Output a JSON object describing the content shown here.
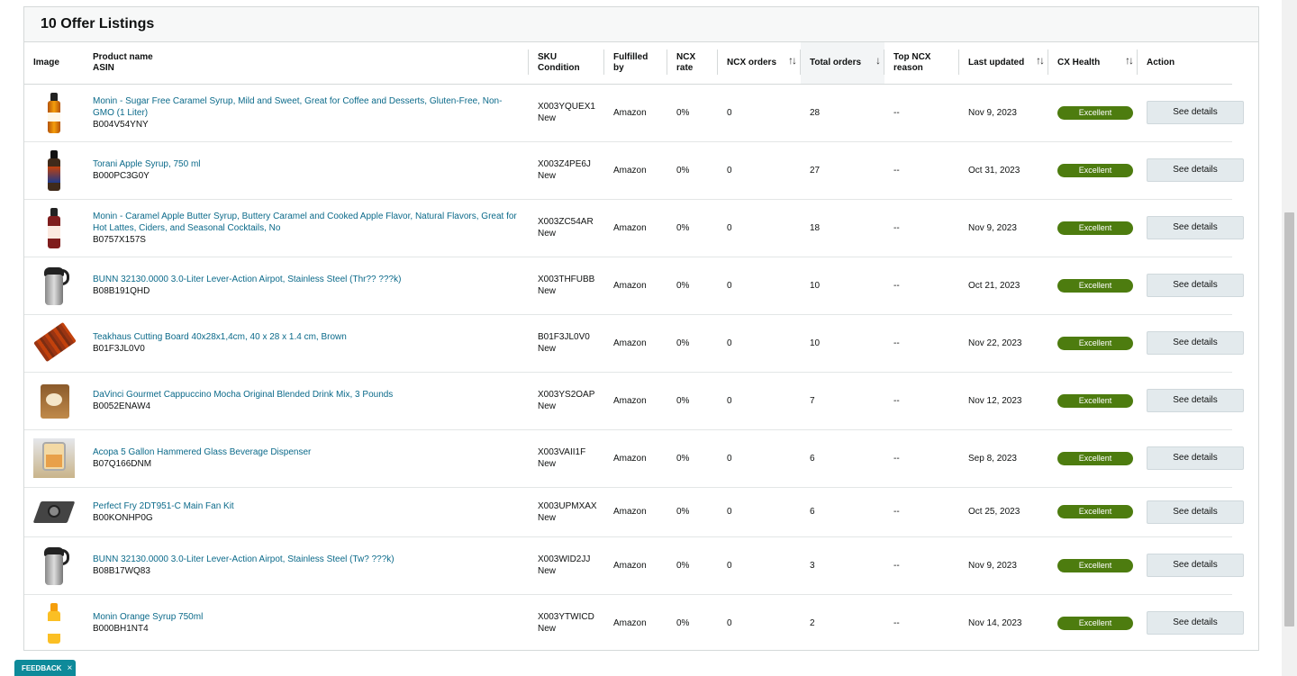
{
  "title": "10 Offer Listings",
  "columns": {
    "image": "Image",
    "product_name": "Product name",
    "asin": "ASIN",
    "sku": "SKU",
    "condition": "Condition",
    "fulfilled_by": "Fulfilled by",
    "ncx_rate": "NCX rate",
    "ncx_orders": "NCX orders",
    "total_orders": "Total orders",
    "top_ncx_reason": "Top NCX reason",
    "last_updated": "Last updated",
    "cx_health": "CX Health",
    "action": "Action"
  },
  "sort_icons": {
    "ncx_orders": "↑↓",
    "total_orders": "↓",
    "last_updated": "↑↓",
    "cx_health": "↑↓"
  },
  "rows": [
    {
      "thumb": "syrup-bottle-amber-icon",
      "name": "Monin - Sugar Free Caramel Syrup, Mild and Sweet, Great for Coffee and Desserts, Gluten-Free, Non-GMO (1 Liter)",
      "asin": "B004V54YNY",
      "sku": "X003YQUEX1",
      "condition": "New",
      "fulfilled_by": "Amazon",
      "ncx_rate": "0%",
      "ncx_orders": "0",
      "total_orders": "28",
      "top_ncx_reason": "--",
      "last_updated": "Nov 9, 2023",
      "cx_health": "Excellent",
      "action": "See details"
    },
    {
      "thumb": "syrup-bottle-dark-icon",
      "name": "Torani Apple Syrup, 750 ml",
      "asin": "B000PC3G0Y",
      "sku": "X003Z4PE6J",
      "condition": "New",
      "fulfilled_by": "Amazon",
      "ncx_rate": "0%",
      "ncx_orders": "0",
      "total_orders": "27",
      "top_ncx_reason": "--",
      "last_updated": "Oct 31, 2023",
      "cx_health": "Excellent",
      "action": "See details"
    },
    {
      "thumb": "syrup-bottle-red-icon",
      "name": "Monin - Caramel Apple Butter Syrup, Buttery Caramel and Cooked Apple Flavor, Natural Flavors, Great for Hot Lattes, Ciders, and Seasonal Cocktails, No",
      "asin": "B0757X157S",
      "sku": "X003ZC54AR",
      "condition": "New",
      "fulfilled_by": "Amazon",
      "ncx_rate": "0%",
      "ncx_orders": "0",
      "total_orders": "18",
      "top_ncx_reason": "--",
      "last_updated": "Nov 9, 2023",
      "cx_health": "Excellent",
      "action": "See details"
    },
    {
      "thumb": "airpot-icon",
      "name": "BUNN 32130.0000 3.0-Liter Lever-Action Airpot, Stainless Steel (Thr?? ???k)",
      "asin": "B08B191QHD",
      "sku": "X003THFUBB",
      "condition": "New",
      "fulfilled_by": "Amazon",
      "ncx_rate": "0%",
      "ncx_orders": "0",
      "total_orders": "10",
      "top_ncx_reason": "--",
      "last_updated": "Oct 21, 2023",
      "cx_health": "Excellent",
      "action": "See details"
    },
    {
      "thumb": "cutting-board-icon",
      "name": "Teakhaus Cutting Board 40x28x1,4cm, 40 x 28 x 1.4 cm, Brown",
      "asin": "B01F3JL0V0",
      "sku": "B01F3JL0V0",
      "condition": "New",
      "fulfilled_by": "Amazon",
      "ncx_rate": "0%",
      "ncx_orders": "0",
      "total_orders": "10",
      "top_ncx_reason": "--",
      "last_updated": "Nov 22, 2023",
      "cx_health": "Excellent",
      "action": "See details"
    },
    {
      "thumb": "drink-mix-bag-icon",
      "name": "DaVinci Gourmet Cappuccino Mocha Original Blended Drink Mix, 3 Pounds",
      "asin": "B0052ENAW4",
      "sku": "X003YS2OAP",
      "condition": "New",
      "fulfilled_by": "Amazon",
      "ncx_rate": "0%",
      "ncx_orders": "0",
      "total_orders": "7",
      "top_ncx_reason": "--",
      "last_updated": "Nov 12, 2023",
      "cx_health": "Excellent",
      "action": "See details"
    },
    {
      "thumb": "beverage-dispenser-icon",
      "name": "Acopa 5 Gallon Hammered Glass Beverage Dispenser",
      "asin": "B07Q166DNM",
      "sku": "X003VAII1F",
      "condition": "New",
      "fulfilled_by": "Amazon",
      "ncx_rate": "0%",
      "ncx_orders": "0",
      "total_orders": "6",
      "top_ncx_reason": "--",
      "last_updated": "Sep 8, 2023",
      "cx_health": "Excellent",
      "action": "See details"
    },
    {
      "thumb": "fan-kit-icon",
      "name": "Perfect Fry 2DT951-C Main Fan Kit",
      "asin": "B00KONHP0G",
      "sku": "X003UPMXAX",
      "condition": "New",
      "fulfilled_by": "Amazon",
      "ncx_rate": "0%",
      "ncx_orders": "0",
      "total_orders": "6",
      "top_ncx_reason": "--",
      "last_updated": "Oct 25, 2023",
      "cx_health": "Excellent",
      "action": "See details"
    },
    {
      "thumb": "airpot-icon",
      "name": "BUNN 32130.0000 3.0-Liter Lever-Action Airpot, Stainless Steel (Tw? ???k)",
      "asin": "B08B17WQ83",
      "sku": "X003WID2JJ",
      "condition": "New",
      "fulfilled_by": "Amazon",
      "ncx_rate": "0%",
      "ncx_orders": "0",
      "total_orders": "3",
      "top_ncx_reason": "--",
      "last_updated": "Nov 9, 2023",
      "cx_health": "Excellent",
      "action": "See details"
    },
    {
      "thumb": "syrup-bottle-orange-icon",
      "name": "Monin Orange Syrup 750ml",
      "asin": "B000BH1NT4",
      "sku": "X003YTWICD",
      "condition": "New",
      "fulfilled_by": "Amazon",
      "ncx_rate": "0%",
      "ncx_orders": "0",
      "total_orders": "2",
      "top_ncx_reason": "--",
      "last_updated": "Nov 14, 2023",
      "cx_health": "Excellent",
      "action": "See details"
    }
  ],
  "feedback": {
    "label": "FEEDBACK",
    "close": "×"
  },
  "colors": {
    "link": "#0b6a8a",
    "badge": "#4d7c0f",
    "button": "#e3eaed",
    "feedback": "#0e8a9a"
  }
}
